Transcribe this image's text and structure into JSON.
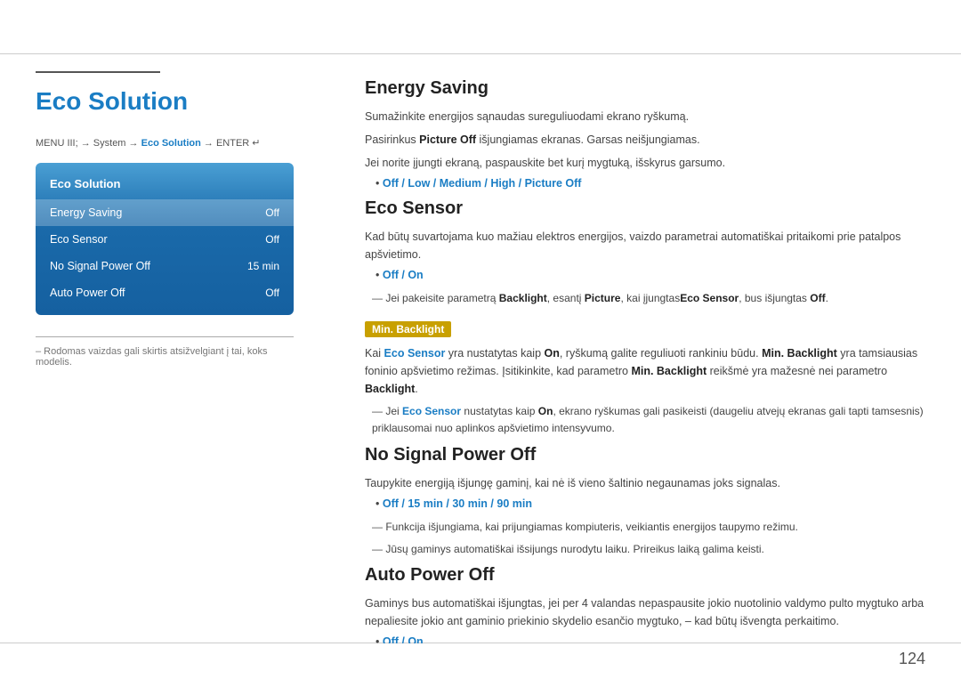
{
  "page": {
    "page_number": "124"
  },
  "breadcrumb": {
    "text": "MENU",
    "arrow1": "→",
    "system": "System",
    "arrow2": "→",
    "eco": "Eco Solution",
    "arrow3": "→",
    "enter": "ENTER"
  },
  "left": {
    "title": "Eco Solution",
    "menu_title": "Eco Solution",
    "menu_items": [
      {
        "label": "Energy Saving",
        "value": "Off",
        "active": true
      },
      {
        "label": "Eco Sensor",
        "value": "Off",
        "active": false
      },
      {
        "label": "No Signal Power Off",
        "value": "15 min",
        "active": false
      },
      {
        "label": "Auto Power Off",
        "value": "Off",
        "active": false
      }
    ],
    "note": "– Rodomas vaizdas gali skirtis atsižvelgiant į tai, koks modelis."
  },
  "right": {
    "energy_saving": {
      "title": "Energy Saving",
      "lines": [
        "Sumažinkite energijos sąnaudas sureguliuodami ekrano ryškumą.",
        "Pasirinkus Picture Off išjungiamas ekranas. Garsas neišjungiamas.",
        "Jei norite įjungti ekraną, paspauskite bet kurį mygtuką, išskyrus garsumo."
      ],
      "options_label": "Off / Low / Medium / High / Picture Off"
    },
    "eco_sensor": {
      "title": "Eco Sensor",
      "line": "Kad būtų suvartojama kuo mažiau elektros energijos, vaizdo parametrai automatiškai pritaikomi prie patalpos apšvietimo.",
      "options_label": "Off / On",
      "dash_note": "Jei pakeisite parametrą Backlight, esantį Picture, kai įjungtas Eco Sensor, bus išjungtas Off."
    },
    "min_backlight": {
      "badge": "Min. Backlight",
      "line1": "Kai Eco Sensor yra nustatytas kaip On, ryškumą galite reguliuoti rankiniu būdu. Min. Backlight yra tamsiausias foninio apšvietimo režimas. Įsitikinkite, kad parametro Min. Backlight reikšmė yra mažesnė nei parametro Backlight.",
      "dash_note": "Jei Eco Sensor nustatytas kaip On, ekrano ryškumas gali pasikeisti (daugeliu atvejų ekranas gali tapti tamsesnis) priklausomai nuo aplinkos apšvietimo intensyvumo."
    },
    "no_signal": {
      "title": "No Signal Power Off",
      "line": "Taupykite energiją išjungę gaminį, kai nė iš vieno šaltinio negaunamas joks signalas.",
      "options_label": "Off / 15 min / 30 min / 90 min",
      "dash1": "Funkcija išjungiama, kai prijungiamas kompiuteris, veikiantis energijos taupymo režimu.",
      "dash2": "Jūsų gaminys automatiškai išsijungs nurodytu laiku. Prireikus laiką galima keisti."
    },
    "auto_power": {
      "title": "Auto Power Off",
      "line": "Gaminys bus automatiškai išjungtas, jei per 4 valandas nepaspausite jokio nuotolinio valdymo pulto mygtuko arba nepaliesite jokio ant gaminio priekinio skydelio esančio mygtuko, – kad būtų išvengta perkaitimo.",
      "options_label": "Off / On"
    }
  }
}
